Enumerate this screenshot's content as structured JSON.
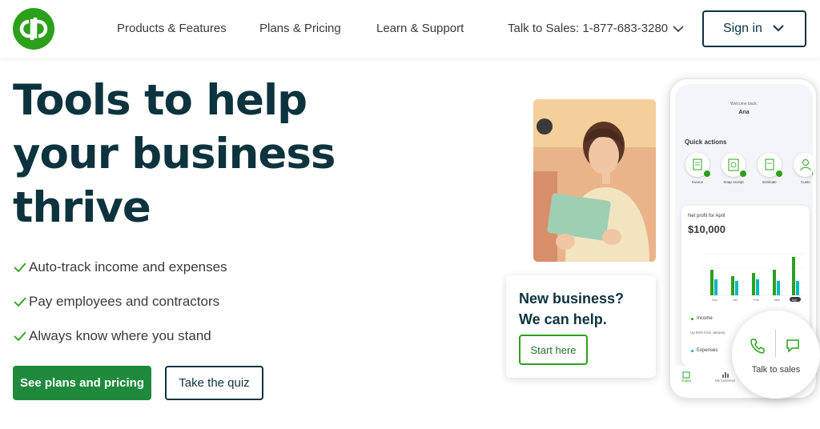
{
  "header": {
    "nav": {
      "products": "Products & Features",
      "plans": "Plans & Pricing",
      "learn": "Learn & Support",
      "sales": "Talk to Sales: 1-877-683-3280"
    },
    "signin": "Sign in"
  },
  "hero": {
    "headline": [
      "Tools to help",
      "your business",
      "thrive"
    ],
    "bullets": [
      "Auto-track income and expenses",
      "Pay employees and contractors",
      "Always know where you stand"
    ],
    "primary_cta": "See plans and pricing",
    "secondary_cta": "Take the quiz"
  },
  "new_business_card": {
    "title_line1": "New business?",
    "title_line2": "We can help.",
    "button": "Start here"
  },
  "phone": {
    "welcome": "Welcome back,",
    "name": "Ana",
    "quick_actions_title": "Quick actions",
    "quick_actions": [
      "Invoice",
      "Snap receipt",
      "Estimate",
      "Custo"
    ],
    "profit_label": "Net profit for April",
    "profit_value": "$10,000",
    "chart_months": [
      "Dec",
      "Jan",
      "Feb",
      "Mar",
      "Apr"
    ],
    "legend_income": "Income",
    "legend_income_sub": "Up 50% from January",
    "legend_expenses": "Expenses",
    "tabs": [
      "Today",
      "My business"
    ]
  },
  "talk_to_sales": "Talk to sales",
  "colors": {
    "brand_green": "#2ca01c",
    "cta_green": "#1f8a3b",
    "dark_teal": "#0d333f",
    "chart_teal": "#00b8c4"
  }
}
